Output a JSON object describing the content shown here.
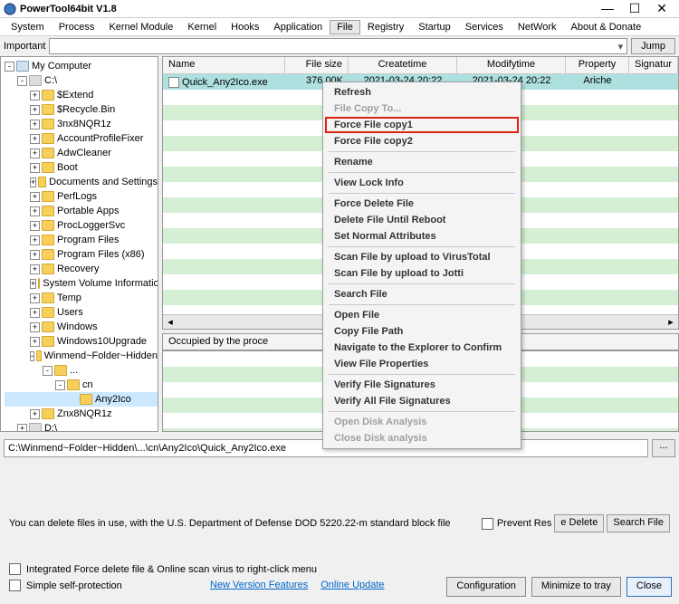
{
  "window": {
    "title": "PowerTool64bit V1.8",
    "min": "—",
    "max": "☐",
    "close": "✕"
  },
  "menu": {
    "items": [
      "System",
      "Process",
      "Kernel Module",
      "Kernel",
      "Hooks",
      "Application",
      "File",
      "Registry",
      "Startup",
      "Services",
      "NetWork",
      "About & Donate"
    ],
    "active_index": 6
  },
  "important": {
    "label": "Important",
    "jump": "Jump"
  },
  "tree": {
    "root": "My Computer",
    "drives": [
      {
        "label": "C:\\",
        "children": [
          "$Extend",
          "$Recycle.Bin",
          "3nx8NQR1z",
          "AccountProfileFixer",
          "AdwCleaner",
          "Boot",
          "Documents and Settings",
          "PerfLogs",
          "Portable Apps",
          "ProcLoggerSvc",
          "Program Files",
          "Program Files (x86)",
          "Recovery",
          "System Volume Information",
          "Temp",
          "Users",
          "Windows",
          "Windows10Upgrade"
        ],
        "winmend": {
          "label": "Winmend~Folder~Hidden",
          "dots": "...",
          "cn": "cn",
          "leaf": "Any2Ico"
        },
        "znx": "Znx8NQR1z"
      },
      {
        "label": "D:\\"
      }
    ]
  },
  "grid": {
    "headers": {
      "name": "Name",
      "size": "File size",
      "ct": "Createtime",
      "mt": "Modifytime",
      "prop": "Property",
      "sig": "Signatur"
    },
    "rows": [
      {
        "name": "Quick_Any2Ico.exe",
        "size": "376.00K",
        "ct": "2021-03-24 20:22",
        "mt": "2021-03-24 20:22",
        "prop": "Ariche",
        "sig": ""
      }
    ]
  },
  "occupied": {
    "label": "Occupied by the proce"
  },
  "path": {
    "value": "C:\\Winmend~Folder~Hidden\\...\\cn\\Any2Ico\\Quick_Any2Ico.exe",
    "dots": "..."
  },
  "footer": {
    "msg": "You can delete files in use, with the U.S. Department of Defense DOD 5220.22-m standard block file",
    "prevent": "Prevent Res",
    "btn_delete": "e Delete",
    "btn_search": "Search File",
    "opt1": "Integrated Force delete file & Online scan virus to right-click menu",
    "opt2": "Simple self-protection",
    "link1": "New Version Features",
    "link2": "Online Update",
    "cfg": "Configuration",
    "min": "Minimize to tray",
    "close": "Close"
  },
  "context_menu": {
    "groups": [
      [
        {
          "label": "Refresh",
          "disabled": false
        },
        {
          "label": "File Copy To...",
          "disabled": true
        },
        {
          "label": "Force File copy1",
          "disabled": false,
          "highlight": true
        },
        {
          "label": "Force File copy2",
          "disabled": false
        }
      ],
      [
        {
          "label": "Rename",
          "disabled": false
        }
      ],
      [
        {
          "label": "View Lock Info",
          "disabled": false
        }
      ],
      [
        {
          "label": "Force Delete File",
          "disabled": false
        },
        {
          "label": "Delete File Until Reboot",
          "disabled": false
        },
        {
          "label": "Set Normal Attributes",
          "disabled": false
        }
      ],
      [
        {
          "label": "Scan File by upload to VirusTotal",
          "disabled": false
        },
        {
          "label": "Scan File by upload to Jotti",
          "disabled": false
        }
      ],
      [
        {
          "label": "Search File",
          "disabled": false
        }
      ],
      [
        {
          "label": "Open File",
          "disabled": false
        },
        {
          "label": "Copy File Path",
          "disabled": false
        },
        {
          "label": "Navigate to the Explorer to Confirm",
          "disabled": false
        },
        {
          "label": "View File Properties",
          "disabled": false
        }
      ],
      [
        {
          "label": "Verify File Signatures",
          "disabled": false
        },
        {
          "label": "Verify All File Signatures",
          "disabled": false
        }
      ],
      [
        {
          "label": "Open Disk Analysis",
          "disabled": true
        },
        {
          "label": "Close Disk analysis",
          "disabled": true
        }
      ]
    ]
  }
}
